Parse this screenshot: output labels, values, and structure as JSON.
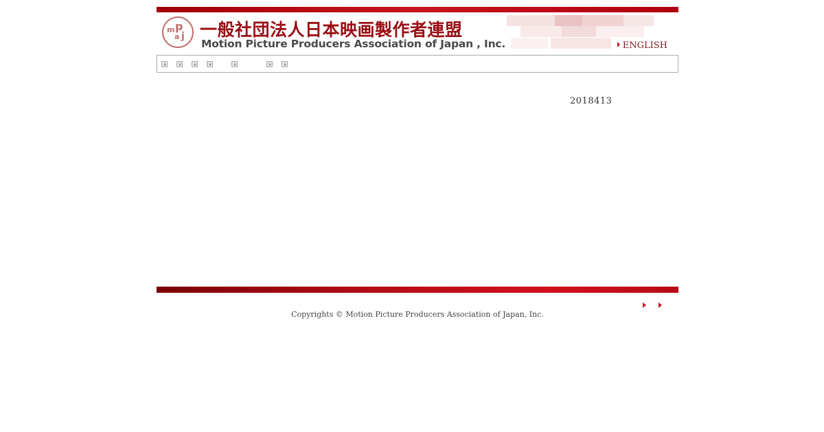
{
  "header": {
    "logo_letters": [
      "m",
      "p",
      "a",
      "j"
    ],
    "title_jp": "一般社団法人日本映画製作者連盟",
    "title_en": "Motion Picture Producers Association of Japan , Inc.",
    "english_link": "ENGLISH"
  },
  "nav": {
    "items": [
      "",
      "",
      "",
      "",
      "",
      "",
      ""
    ]
  },
  "main": {
    "date": "2018413"
  },
  "footer": {
    "links": [
      "",
      ""
    ],
    "copyright": "Copyrights © Motion Picture Producers Association of Japan, Inc."
  },
  "colors": {
    "brand_red": "#c0141e",
    "title_red": "#9a0f14",
    "logo_pink": "#c46d6d"
  }
}
